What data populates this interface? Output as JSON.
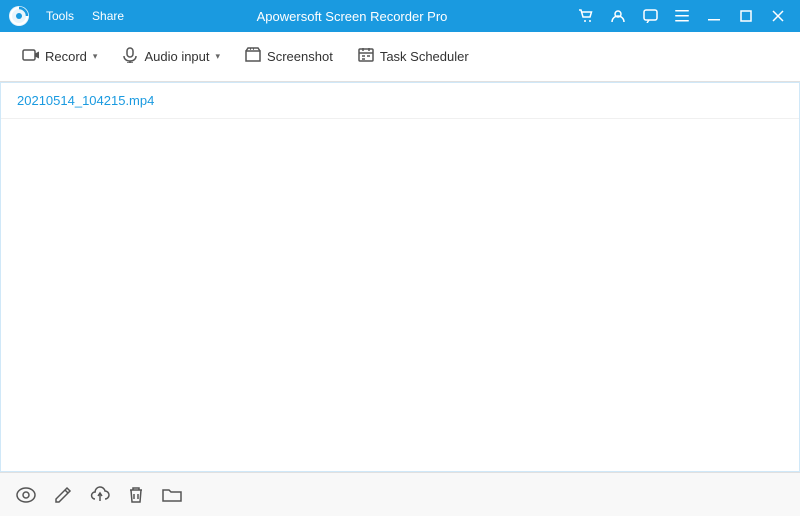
{
  "titlebar": {
    "app_name": "Apowersoft Screen Recorder Pro",
    "menu_items": [
      "Tools",
      "Share"
    ]
  },
  "toolbar": {
    "record_label": "Record",
    "audio_input_label": "Audio input",
    "screenshot_label": "Screenshot",
    "task_scheduler_label": "Task Scheduler"
  },
  "file_list": {
    "items": [
      {
        "name": "20210514_104215.mp4"
      }
    ]
  },
  "bottom_bar": {
    "icons": [
      "eye",
      "edit",
      "cloud",
      "delete",
      "folder"
    ]
  },
  "window_controls": {
    "cart_icon": "🛒",
    "user_icon": "👤",
    "chat_icon": "💬",
    "menu_icon": "☰",
    "minimize_icon": "─",
    "maximize_icon": "□",
    "close_icon": "✕"
  }
}
